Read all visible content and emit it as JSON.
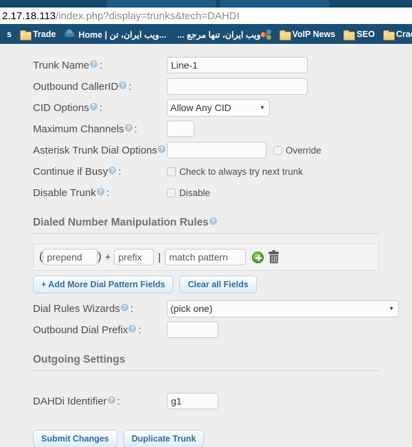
{
  "browser": {
    "url_host": "2.17.18.113",
    "url_path": "/index.php?display=trunks&tech=DAHDI",
    "bookmarks": [
      {
        "label": "s",
        "icon": "text-bookmark",
        "rtl": false
      },
      {
        "label": "Trade",
        "icon": "folder-icon",
        "rtl": false
      },
      {
        "label": "Home | ویب ایران، تن...",
        "icon": "home-icon",
        "rtl": false
      },
      {
        "label": "ویب ایران، تنها مرجع ...",
        "icon": "joomla-icon",
        "rtl": true
      },
      {
        "label": "VoIP News",
        "icon": "folder-icon",
        "rtl": false
      },
      {
        "label": "SEO",
        "icon": "folder-icon",
        "rtl": false
      },
      {
        "label": "Crack & Ha",
        "icon": "folder-icon",
        "rtl": false
      }
    ]
  },
  "form": {
    "help_glyph": "?",
    "colon": ":",
    "fields": {
      "trunk_name": {
        "label": "Trunk Name",
        "value": "Line-1",
        "placeholder": ""
      },
      "outbound_callerid": {
        "label": "Outbound CallerID",
        "value": "",
        "placeholder": ""
      },
      "cid_options": {
        "label": "CID Options",
        "selected": "Allow Any CID",
        "options": [
          "Allow Any CID"
        ]
      },
      "maximum_channels": {
        "label": "Maximum Channels",
        "value": "",
        "placeholder": ""
      },
      "asterisk_trunk_dial_options": {
        "label": "Asterisk Trunk Dial Options",
        "value": "",
        "placeholder": "",
        "override_label": "Override",
        "override_checked": false
      },
      "continue_if_busy": {
        "label": "Continue if Busy",
        "checkbox_label": "Check to always try next trunk",
        "checked": false
      },
      "disable_trunk": {
        "label": "Disable Trunk",
        "checkbox_label": "Disable",
        "checked": false
      }
    }
  },
  "dialed_rules": {
    "section_title": "Dialed Number Manipulation Rules",
    "prepend_open": "(",
    "prepend_close": ")",
    "plus": "+",
    "pipe": "|",
    "prepend_placeholder": "prepend",
    "prefix_placeholder": "prefix",
    "match_placeholder": "match pattern",
    "prepend_value": "",
    "prefix_value": "",
    "match_value": "",
    "add_button": "+ Add More Dial Pattern Fields",
    "clear_button": "Clear all Fields",
    "dial_rules_wizards": {
      "label": "Dial Rules Wizards",
      "selected": "(pick one)",
      "options": [
        "(pick one)"
      ]
    },
    "outbound_dial_prefix": {
      "label": "Outbound Dial Prefix",
      "value": "",
      "placeholder": ""
    }
  },
  "outgoing": {
    "section_title": "Outgoing Settings",
    "dahdi_identifier": {
      "label": "DAHDi Identifier",
      "value": "g1",
      "placeholder": ""
    },
    "submit_button": "Submit Changes",
    "duplicate_button": "Duplicate Trunk"
  },
  "colors": {
    "chrome_blue": "#1b5278",
    "bookmark_bar": "#1b4e74",
    "page_bg": "#eeeeee",
    "help_icon": "#a9c6dd",
    "button_text": "#2e6ea3",
    "focus_border": "#4a90d9",
    "add_icon_green": "#3f9b24"
  }
}
